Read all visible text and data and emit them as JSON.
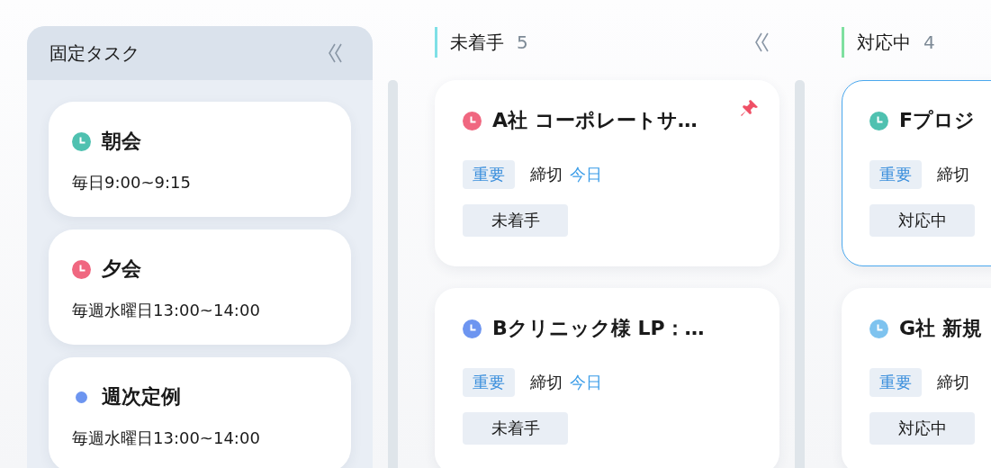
{
  "fixed_tasks": {
    "title": "固定タスク",
    "items": [
      {
        "title": "朝会",
        "schedule": "毎日9:00~9:15",
        "kind": "clock",
        "color": "#4fc1b0"
      },
      {
        "title": "夕会",
        "schedule": "毎週水曜日13:00~14:00",
        "kind": "clock",
        "color": "#f06780"
      },
      {
        "title": "週次定例",
        "schedule": "毎週水曜日13:00~14:00",
        "kind": "dot",
        "color": "#6d95f0"
      }
    ]
  },
  "columns": [
    {
      "title": "未着手",
      "count": "5",
      "color": "#7ee0e6",
      "collapsible": true,
      "cards": [
        {
          "title": "A社 コーポレートサ…",
          "color": "#f06780",
          "priority": "重要",
          "due_label": "締切",
          "due": "今日",
          "status": "未着手",
          "pinned": true,
          "selected": false
        },
        {
          "title": "Bクリニック様 LP：…",
          "color": "#6d95f0",
          "priority": "重要",
          "due_label": "締切",
          "due": "今日",
          "status": "未着手",
          "pinned": false,
          "selected": false
        }
      ]
    },
    {
      "title": "対応中",
      "count": "4",
      "color": "#7fe0a0",
      "collapsible": false,
      "cards": [
        {
          "title": "Fプロジ",
          "color": "#4fc1b0",
          "priority": "重要",
          "due_label": "締切",
          "status": "対応中",
          "selected": true
        },
        {
          "title": "G社 新規",
          "color": "#7ec3ef",
          "priority": "重要",
          "due_label": "締切",
          "status": "対応中",
          "selected": false
        }
      ]
    }
  ]
}
